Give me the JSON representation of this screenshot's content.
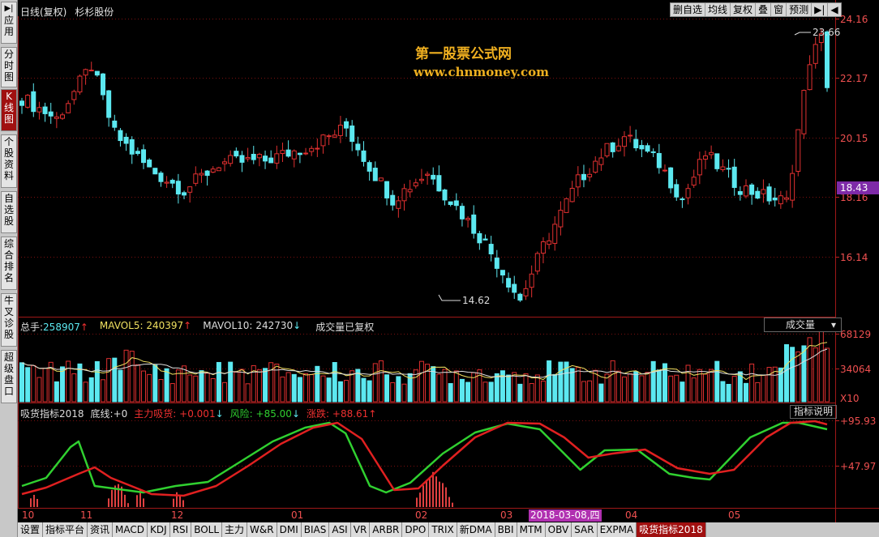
{
  "sidebar": {
    "items": [
      {
        "label": "应用",
        "active": false
      },
      {
        "label": "分时图",
        "active": false
      },
      {
        "label": "K线图",
        "active": true
      },
      {
        "label": "个股资料",
        "active": false
      },
      {
        "label": "自选股",
        "active": false
      },
      {
        "label": "综合排名",
        "active": false
      },
      {
        "label": "牛叉诊股",
        "active": false
      },
      {
        "label": "超级盘口",
        "active": false
      }
    ],
    "top_arrow": "▶|"
  },
  "header": {
    "period": "日线(复权)",
    "stock_name": "杉杉股份"
  },
  "toolbar": {
    "buttons": [
      "删自选",
      "均线",
      "复权",
      "叠",
      "窗",
      "预测",
      "▶|",
      "◀"
    ]
  },
  "watermark": {
    "line1": "第一股票公式网",
    "line2": "www.chnmoney.com"
  },
  "price_axis": {
    "labels": [
      "24.16",
      "22.17",
      "20.15",
      "18.16",
      "16.14"
    ],
    "current_price": "18.43",
    "high_label": "23.66",
    "low_label": "14.62"
  },
  "volume": {
    "total_label": "总手:",
    "total_value": "258907",
    "mavol5_label": "MAVOL5:",
    "mavol5_value": "240397",
    "mavol10_label": "MAVOL10:",
    "mavol10_value": "242730",
    "note": "成交量已复权",
    "selector": "成交量",
    "axis_labels": [
      "68129",
      "34064",
      "X10"
    ]
  },
  "indicator": {
    "name": "吸货指标2018",
    "base_label": "底线:",
    "base_value": "+0",
    "main_label": "主力吸货:",
    "main_value": "+0.001",
    "risk_label": "风险:",
    "risk_value": "+85.00",
    "change_label": "涨跌:",
    "change_value": "+88.61",
    "help_button": "指标说明",
    "axis_labels": [
      "+95.93",
      "+47.97"
    ]
  },
  "date_axis": {
    "labels": [
      "10",
      "11",
      "12",
      "01",
      "02",
      "03",
      "04",
      "05"
    ],
    "highlight": "2018-03-08,四"
  },
  "bottom_tabs": {
    "items": [
      "设置",
      "指标平台",
      "资讯",
      "MACD",
      "KDJ",
      "RSI",
      "BOLL",
      "主力",
      "W&R",
      "DMI",
      "BIAS",
      "ASI",
      "VR",
      "ARBR",
      "DPO",
      "TRIX",
      "新DMA",
      "BBI",
      "MTM",
      "OBV",
      "SAR",
      "EXPMA",
      "吸货指标2018"
    ],
    "active": "吸货指标2018"
  },
  "colors": {
    "up": "#e03030",
    "down": "#5ce8f0",
    "grid": "#7a1010",
    "axis_text": "#f05050",
    "green_line": "#30d030",
    "red_line": "#e02020",
    "highlight": "#b030b0"
  }
}
